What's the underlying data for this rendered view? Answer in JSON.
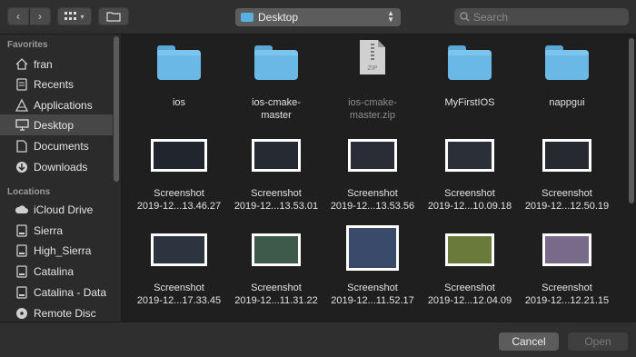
{
  "toolbar": {
    "location": "Desktop",
    "search_placeholder": "Search"
  },
  "sidebar": {
    "favorites_header": "Favorites",
    "favorites": [
      {
        "label": "fran",
        "icon": "home-icon"
      },
      {
        "label": "Recents",
        "icon": "recents-icon"
      },
      {
        "label": "Applications",
        "icon": "applications-icon"
      },
      {
        "label": "Desktop",
        "icon": "desktop-icon",
        "selected": true
      },
      {
        "label": "Documents",
        "icon": "documents-icon"
      },
      {
        "label": "Downloads",
        "icon": "downloads-icon"
      }
    ],
    "locations_header": "Locations",
    "locations": [
      {
        "label": "iCloud Drive",
        "icon": "cloud-icon"
      },
      {
        "label": "Sierra",
        "icon": "disk-icon"
      },
      {
        "label": "High_Sierra",
        "icon": "disk-icon"
      },
      {
        "label": "Catalina",
        "icon": "disk-icon"
      },
      {
        "label": "Catalina - Data",
        "icon": "disk-icon"
      },
      {
        "label": "Remote Disc",
        "icon": "remote-disc-icon"
      }
    ]
  },
  "files": {
    "row1": [
      {
        "line1": "ios",
        "line2": "",
        "type": "folder"
      },
      {
        "line1": "ios-cmake-",
        "line2": "master",
        "type": "folder"
      },
      {
        "line1": "ios-cmake-",
        "line2": "master.zip",
        "type": "zip",
        "dim": true
      },
      {
        "line1": "MyFirstIOS",
        "line2": "",
        "type": "folder"
      },
      {
        "line1": "nappgui",
        "line2": "",
        "type": "folder"
      }
    ],
    "row2": [
      {
        "line1": "Screenshot",
        "line2": "2019-12...13.46.27"
      },
      {
        "line1": "Screenshot",
        "line2": "2019-12...13.53.01"
      },
      {
        "line1": "Screenshot",
        "line2": "2019-12...13.53.56"
      },
      {
        "line1": "Screenshot",
        "line2": "2019-12...10.09.18"
      },
      {
        "line1": "Screenshot",
        "line2": "2019-12...12.50.19"
      }
    ],
    "row3": [
      {
        "line1": "Screenshot",
        "line2": "2019-12...17.33.45"
      },
      {
        "line1": "Screenshot",
        "line2": "2019-12...11.31.22"
      },
      {
        "line1": "Screenshot",
        "line2": "2019-12...11.52.17"
      },
      {
        "line1": "Screenshot",
        "line2": "2019-12...12.04.09"
      },
      {
        "line1": "Screenshot",
        "line2": "2019-12...12.21.15"
      }
    ],
    "zip_badge": "ZIP"
  },
  "buttons": {
    "cancel": "Cancel",
    "open": "Open"
  },
  "colors": {
    "folder_blue": "#6ab8e6",
    "selection": "#474747",
    "background": "#1f1f1f"
  }
}
